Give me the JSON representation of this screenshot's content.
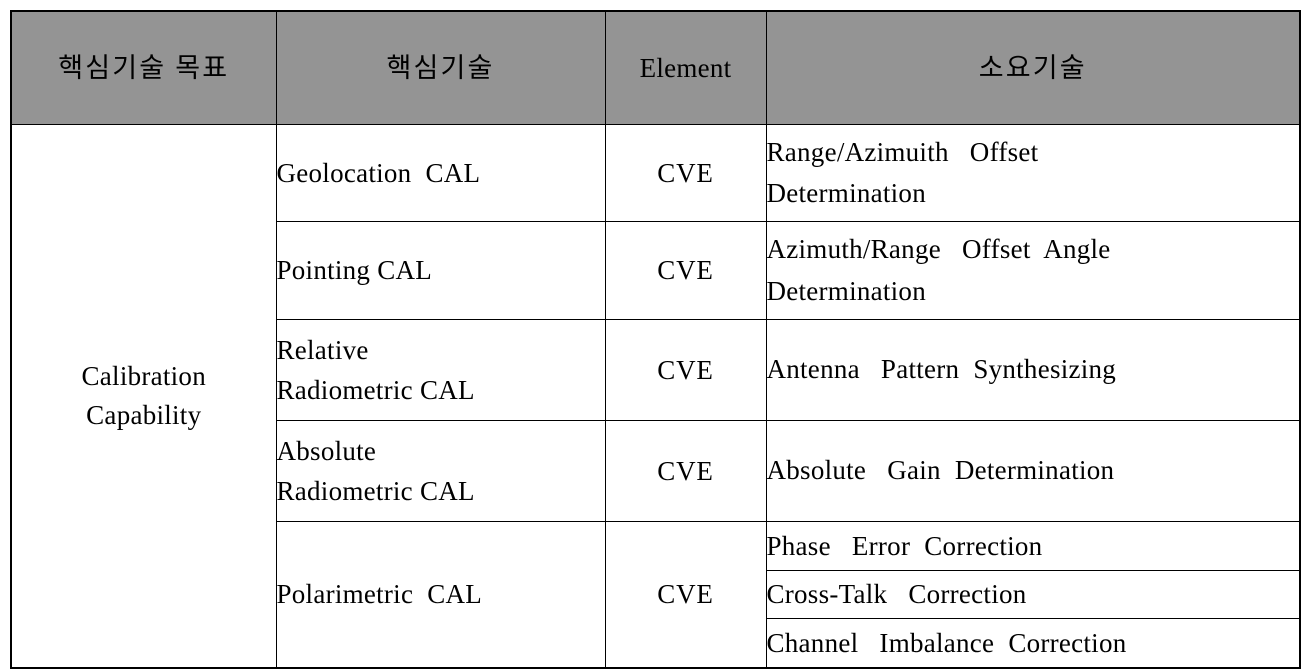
{
  "table": {
    "headers": [
      {
        "label": "핵심기술 목표",
        "name": "goal"
      },
      {
        "label": "핵심기술",
        "name": "core-tech"
      },
      {
        "label": "Element",
        "name": "element"
      },
      {
        "label": "소요기술",
        "name": "required-tech"
      }
    ],
    "goal_group": {
      "line1": "Calibration",
      "line2": "Capability"
    },
    "rows": [
      {
        "core_tech_line1": "Geolocation  CAL",
        "core_tech_line2": "",
        "element": "CVE",
        "required_line1": "Range/Azimuith   Offset",
        "required_line2": "Determination"
      },
      {
        "core_tech_line1": "Pointing CAL",
        "core_tech_line2": "",
        "element": "CVE",
        "required_line1": "Azimuth/Range   Offset  Angle",
        "required_line2": "Determination"
      },
      {
        "core_tech_line1": "Relative",
        "core_tech_line2": "Radiometric CAL",
        "element": "CVE",
        "required_line1": "Antenna   Pattern  Synthesizing",
        "required_line2": ""
      },
      {
        "core_tech_line1": "Absolute",
        "core_tech_line2": "Radiometric CAL",
        "element": "CVE",
        "required_line1": "Absolute   Gain  Determination",
        "required_line2": ""
      }
    ],
    "polarimetric_group": {
      "core_tech": "Polarimetric  CAL",
      "element": "CVE",
      "sub_rows": [
        {
          "required": "Phase   Error  Correction"
        },
        {
          "required": "Cross-Talk   Correction"
        },
        {
          "required": "Channel   Imbalance  Correction"
        }
      ]
    }
  },
  "colors": {
    "header_background": "#949494",
    "border": "#000000",
    "text": "#000000",
    "cell_background": "#ffffff"
  }
}
